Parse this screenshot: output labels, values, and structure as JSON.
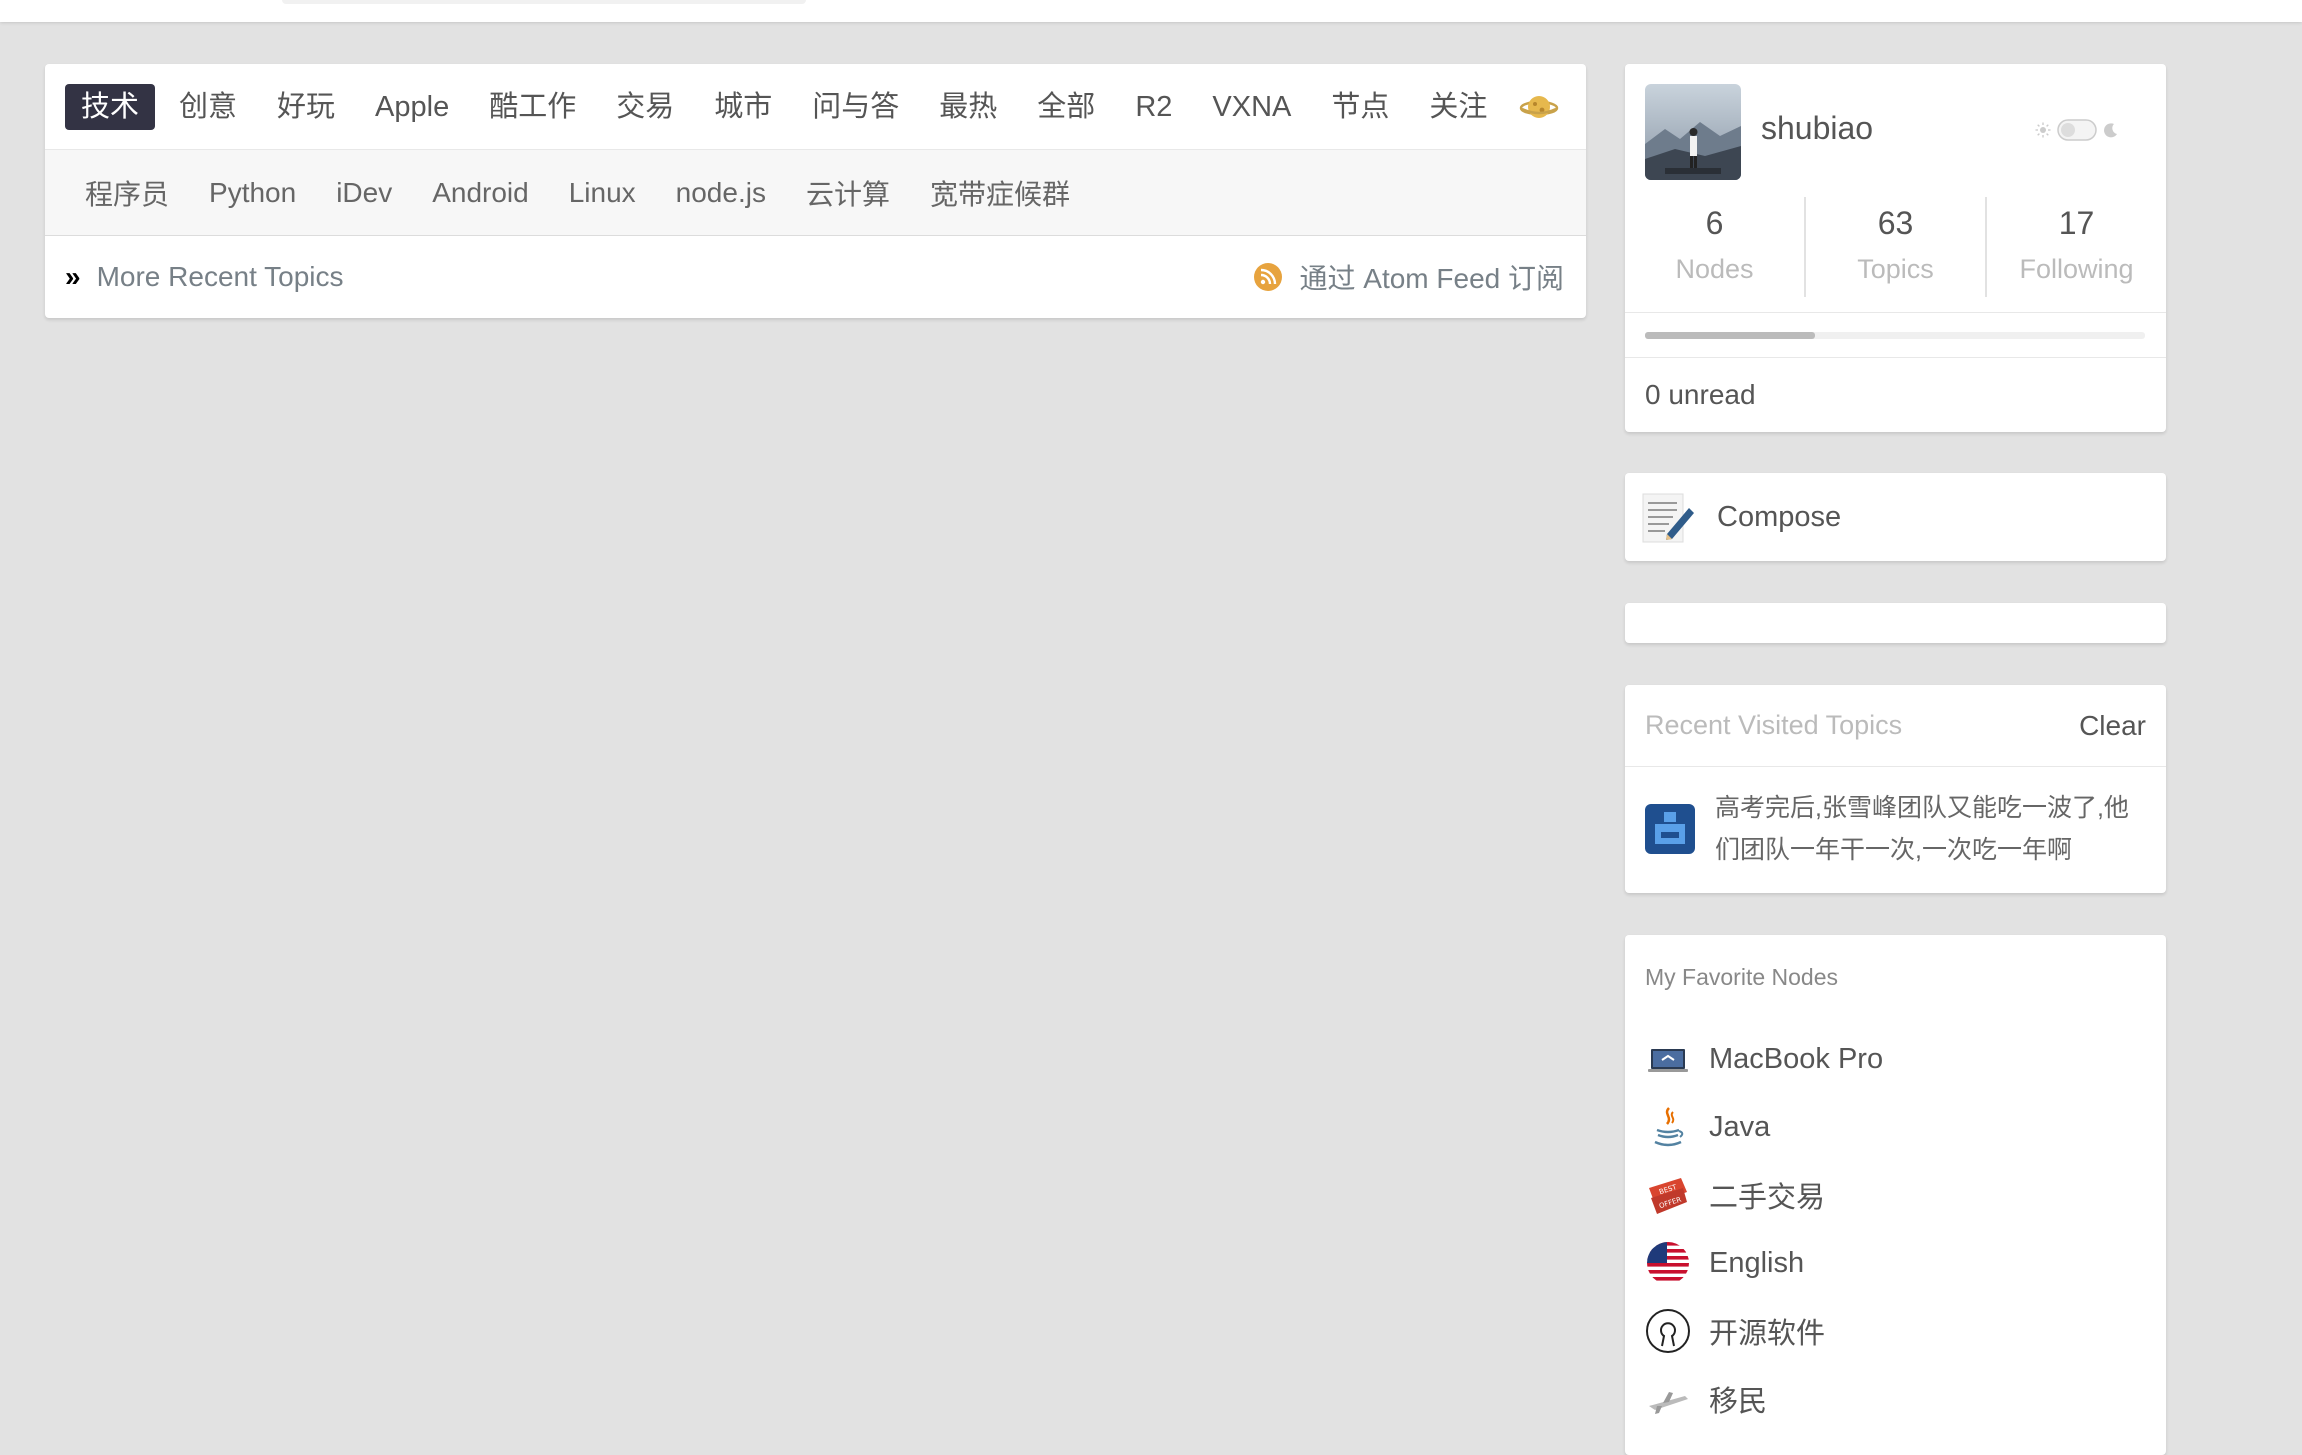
{
  "tabs": {
    "items": [
      {
        "label": "技术",
        "active": true
      },
      {
        "label": "创意"
      },
      {
        "label": "好玩"
      },
      {
        "label": "Apple"
      },
      {
        "label": "酷工作"
      },
      {
        "label": "交易"
      },
      {
        "label": "城市"
      },
      {
        "label": "问与答"
      },
      {
        "label": "最热"
      },
      {
        "label": "全部"
      },
      {
        "label": "R2"
      },
      {
        "label": "VXNA"
      },
      {
        "label": "节点"
      },
      {
        "label": "关注"
      }
    ],
    "extra_icon": "planet-icon"
  },
  "subtabs": [
    "程序员",
    "Python",
    "iDev",
    "Android",
    "Linux",
    "node.js",
    "云计算",
    "宽带症候群"
  ],
  "recent": {
    "prefix": "»",
    "link": "More Recent Topics",
    "atom": "通过 Atom Feed 订阅",
    "atom_icon": "rss-icon"
  },
  "user": {
    "name": "shubiao",
    "avatar_icon": "user-avatar",
    "stats": [
      {
        "value": "6",
        "label": "Nodes"
      },
      {
        "value": "63",
        "label": "Topics"
      },
      {
        "value": "17",
        "label": "Following"
      }
    ],
    "progress": 0.34,
    "unread": "0 unread",
    "theme_icons": [
      "sun-icon",
      "toggle-icon",
      "moon-icon"
    ]
  },
  "compose": {
    "label": "Compose",
    "icon": "compose-icon"
  },
  "recent_visited": {
    "title": "Recent Visited Topics",
    "clear": "Clear",
    "items": [
      {
        "text": "高考完后,张雪峰团队又能吃一波了,他们团队一年干一次,一次吃一年啊",
        "icon": "topic-avatar-icon"
      }
    ]
  },
  "favorites": {
    "title": "My Favorite Nodes",
    "items": [
      {
        "label": "MacBook Pro",
        "icon": "macbook-icon"
      },
      {
        "label": "Java",
        "icon": "java-icon"
      },
      {
        "label": "二手交易",
        "icon": "best-offer-icon"
      },
      {
        "label": "English",
        "icon": "us-flag-icon"
      },
      {
        "label": "开源软件",
        "icon": "open-source-icon"
      },
      {
        "label": "移民",
        "icon": "airplane-icon"
      }
    ]
  },
  "colors": {
    "background": "#e2e2e2",
    "active_tab": "#333344",
    "link_gray": "#778087",
    "rss_orange": "#e7a33e"
  }
}
